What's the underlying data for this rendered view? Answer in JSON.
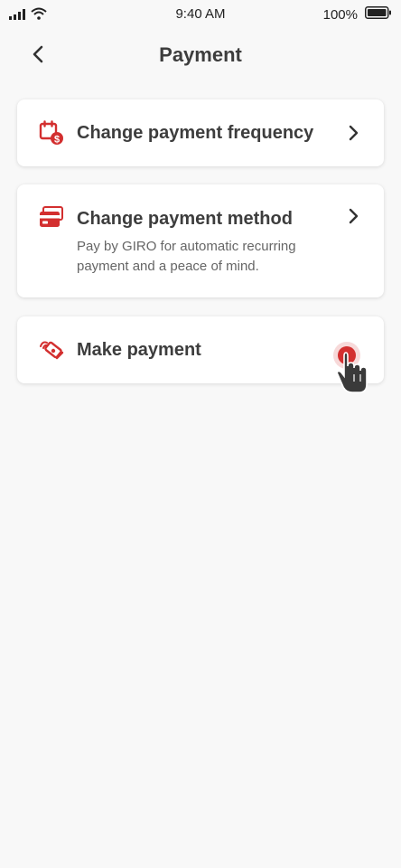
{
  "status_bar": {
    "time": "9:40 AM",
    "battery_percent": "100%",
    "signal_icon": "cellular-signal-icon",
    "wifi_icon": "wifi-icon",
    "battery_icon": "battery-full-icon"
  },
  "header": {
    "title": "Payment",
    "back_icon": "chevron-left-icon"
  },
  "options": [
    {
      "title": "Change payment frequency",
      "icon": "calendar-dollar-icon",
      "chevron_icon": "chevron-right-icon"
    },
    {
      "title": "Change payment method",
      "description": "Pay by GIRO for automatic recurring payment and a peace of mind.",
      "icon": "credit-card-icon",
      "chevron_icon": "chevron-right-icon"
    },
    {
      "title": "Make payment",
      "icon": "hand-payment-icon"
    }
  ],
  "colors": {
    "accent": "#d32f2f",
    "background": "#f8f8f8",
    "card": "#ffffff",
    "text_primary": "#3d3d3d",
    "text_secondary": "#666666"
  },
  "tap_indicator": {
    "icon": "touch-hand-icon"
  }
}
